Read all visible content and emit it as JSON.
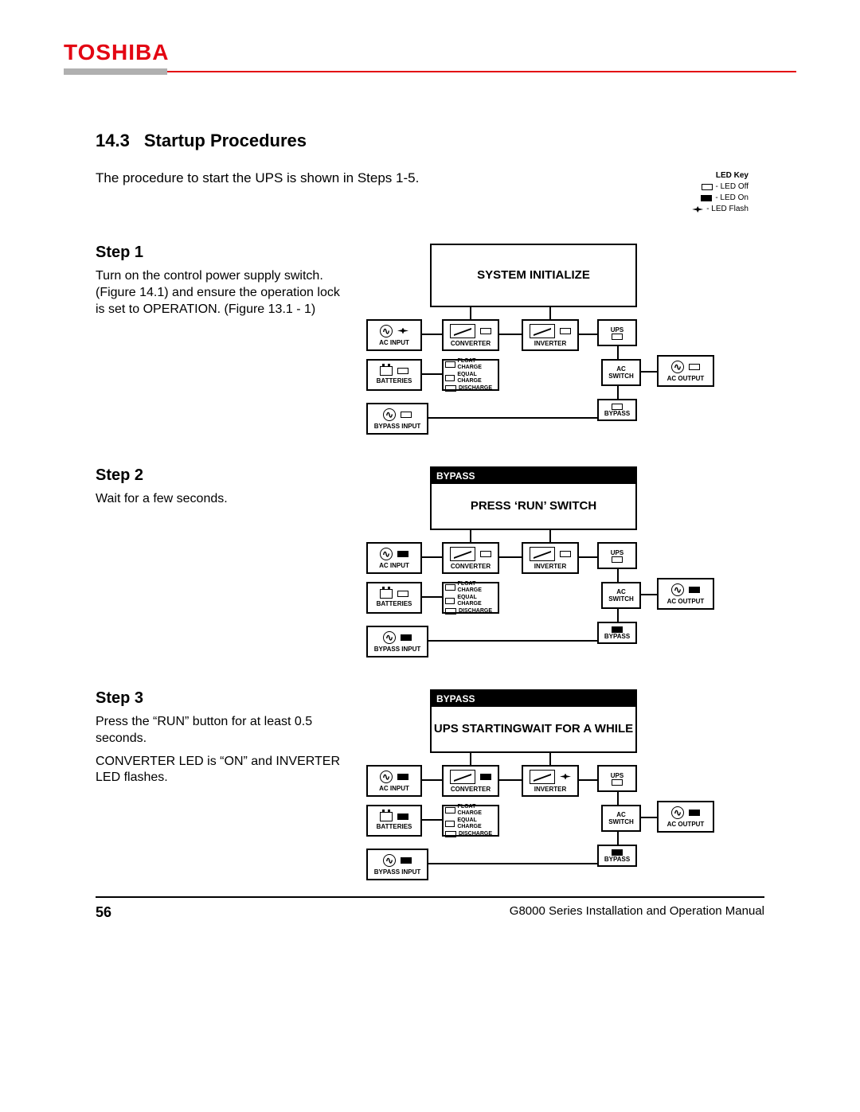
{
  "brand": "TOSHIBA",
  "section": {
    "number": "14.3",
    "title": "Startup Procedures",
    "intro": "The procedure to start the UPS is shown in Steps 1-5."
  },
  "led_key": {
    "title": "LED Key",
    "off": "- LED Off",
    "on": "- LED On",
    "flash": "- LED Flash"
  },
  "steps": [
    {
      "heading": "Step 1",
      "body": [
        "Turn on the control power supply switch. (Figure 14.1) and ensure the operation lock is set to OPERATION. (Figure 13.1 - 1)"
      ],
      "display": {
        "bypass": false,
        "lines": [
          "SYSTEM INITIALIZE"
        ]
      },
      "leds": {
        "ac_input": "flash",
        "converter": "off",
        "inverter": "off",
        "ups": "off",
        "batteries": "off",
        "bypass_input": "off",
        "bypass": "off",
        "ac_output": "off"
      }
    },
    {
      "heading": "Step 2",
      "body": [
        "Wait for a few seconds."
      ],
      "display": {
        "bypass": true,
        "lines": [
          "PRESS ‘RUN’ SWITCH"
        ]
      },
      "leds": {
        "ac_input": "on",
        "converter": "off",
        "inverter": "off",
        "ups": "off",
        "batteries": "off",
        "bypass_input": "on",
        "bypass": "on",
        "ac_output": "on"
      }
    },
    {
      "heading": "Step 3",
      "body": [
        "Press the “RUN” button for at least 0.5 seconds.",
        "CONVERTER LED is “ON” and INVERTER LED flashes."
      ],
      "display": {
        "bypass": true,
        "lines": [
          "UPS STARTING",
          "WAIT FOR A WHILE"
        ]
      },
      "leds": {
        "ac_input": "on",
        "converter": "on",
        "inverter": "flash",
        "ups": "off",
        "batteries": "on",
        "bypass_input": "on",
        "bypass": "on",
        "ac_output": "on"
      }
    }
  ],
  "diagram_labels": {
    "ac_input": "AC INPUT",
    "converter": "CONVERTER",
    "inverter": "INVERTER",
    "ups": "UPS",
    "batteries": "BATTERIES",
    "float_charge": "FLOAT CHARGE",
    "equal_charge": "EQUAL CHARGE",
    "discharge": "DISCHARGE",
    "ac_switch": "AC\nSWITCH",
    "ac_output": "AC OUTPUT",
    "bypass_input": "BYPASS INPUT",
    "bypass": "BYPASS",
    "bypass_bar": "BYPASS"
  },
  "footer": {
    "page": "56",
    "manual": "G8000 Series Installation and Operation Manual"
  }
}
